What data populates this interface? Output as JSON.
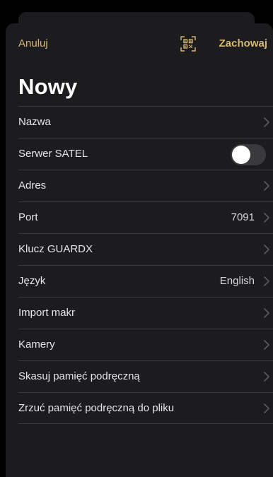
{
  "nav": {
    "cancel_label": "Anuluj",
    "save_label": "Zachowaj",
    "qr_icon": "qr-scan-icon",
    "accent_color": "#d6b877"
  },
  "page": {
    "title": "Nowy"
  },
  "settings": [
    {
      "label": "Nazwa",
      "value": "",
      "control": "chevron"
    },
    {
      "label": "Serwer SATEL",
      "value": "",
      "control": "toggle",
      "toggle_on": false
    },
    {
      "label": "Adres",
      "value": "",
      "control": "chevron"
    },
    {
      "label": "Port",
      "value": "7091",
      "control": "chevron"
    },
    {
      "label": "Klucz GUARDX",
      "value": "",
      "control": "chevron"
    },
    {
      "label": "Język",
      "value": "English",
      "control": "chevron"
    },
    {
      "label": "Import makr",
      "value": "",
      "control": "chevron"
    },
    {
      "label": "Kamery",
      "value": "",
      "control": "chevron"
    },
    {
      "label": "Skasuj pamięć podręczną",
      "value": "",
      "control": "chevron"
    },
    {
      "label": "Zrzuć pamięć podręczną do pliku",
      "value": "",
      "control": "chevron"
    }
  ]
}
